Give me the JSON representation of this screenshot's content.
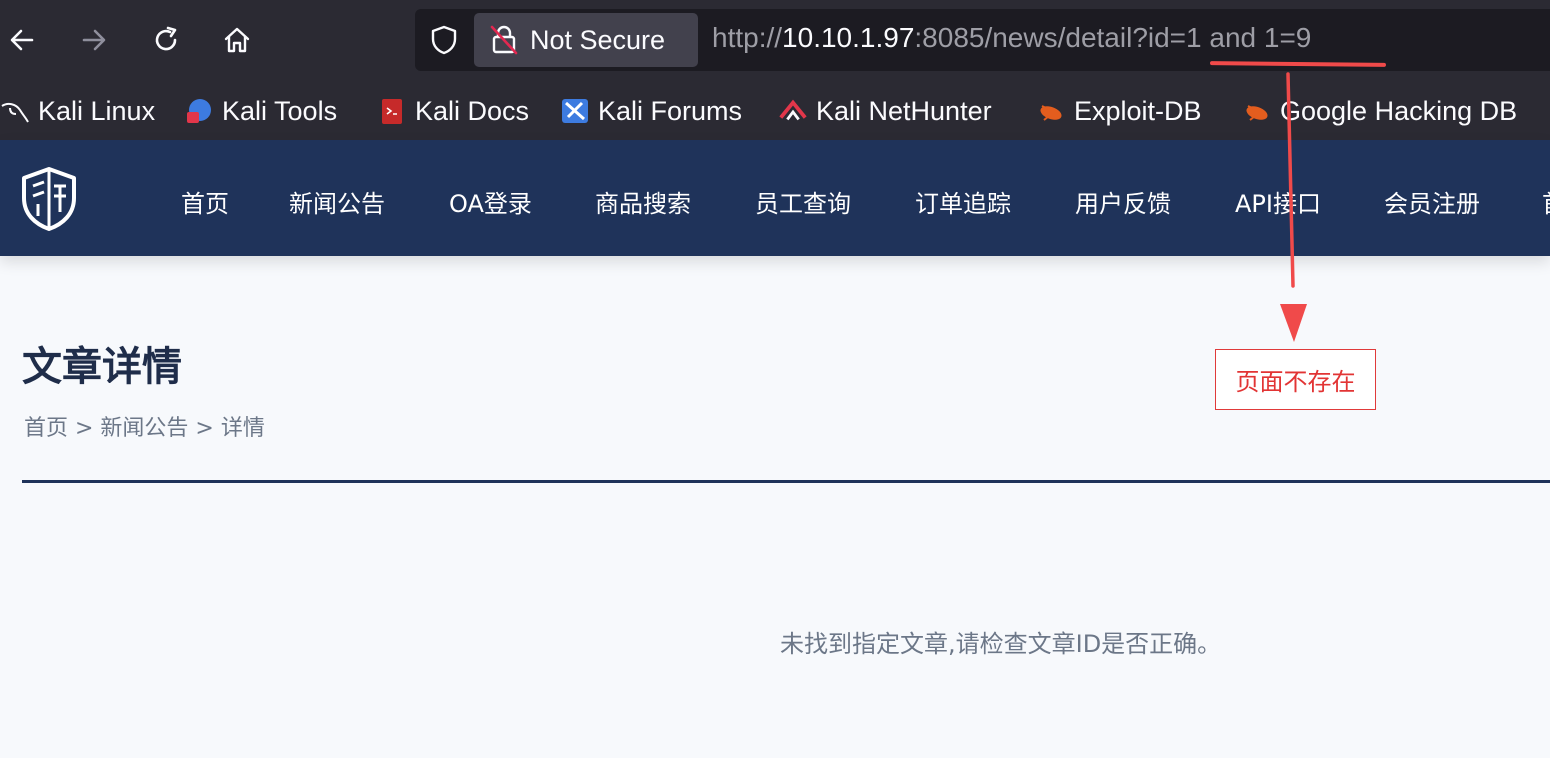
{
  "browser": {
    "security_label": "Not Secure",
    "url": {
      "scheme": "http://",
      "host": "10.10.1.97",
      "rest": ":8085/news/detail?id=1 and 1=9"
    },
    "bookmarks": [
      {
        "label": "Kali Linux",
        "icon": "kali-dragon-icon"
      },
      {
        "label": "Kali Tools",
        "icon": "kali-tools-icon"
      },
      {
        "label": "Kali Docs",
        "icon": "kali-docs-icon"
      },
      {
        "label": "Kali Forums",
        "icon": "kali-forums-icon"
      },
      {
        "label": "Kali NetHunter",
        "icon": "kali-nethunter-icon"
      },
      {
        "label": "Exploit-DB",
        "icon": "exploit-db-icon"
      },
      {
        "label": "Google Hacking DB",
        "icon": "google-hacking-db-icon"
      }
    ]
  },
  "site": {
    "nav": [
      {
        "label": "首页"
      },
      {
        "label": "新闻公告"
      },
      {
        "label": "OA登录"
      },
      {
        "label": "商品搜索"
      },
      {
        "label": "员工查询"
      },
      {
        "label": "订单追踪"
      },
      {
        "label": "用户反馈"
      },
      {
        "label": "API接口"
      },
      {
        "label": "会员注册"
      },
      {
        "label": "首"
      }
    ],
    "page_title": "文章详情",
    "breadcrumb": "首页 > 新闻公告 > 详情",
    "empty_message": "未找到指定文章,请检查文章ID是否正确。"
  },
  "annotation": {
    "label": "页面不存在",
    "color": "#e23434"
  },
  "colors": {
    "nav_bg": "#1f335a",
    "browser_bg": "#2b2a33",
    "page_bg": "#f7f9fc"
  }
}
